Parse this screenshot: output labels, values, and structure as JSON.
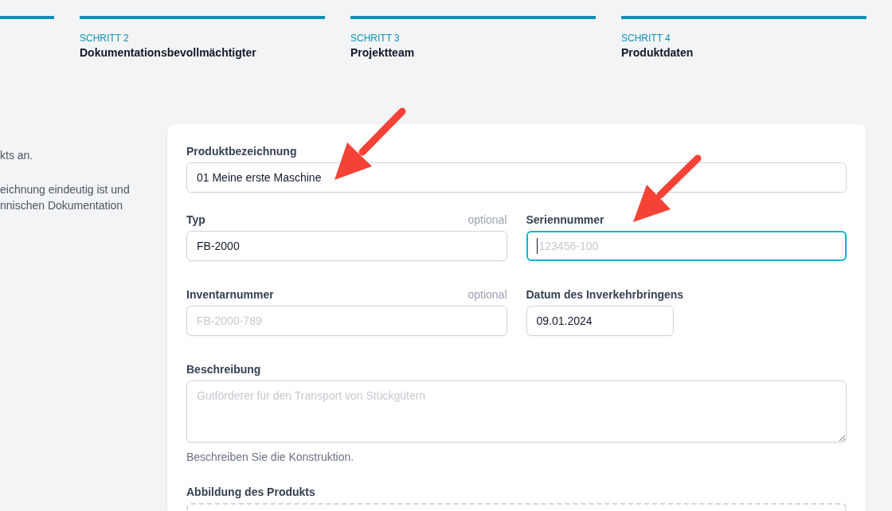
{
  "steps": [
    {
      "complete": true
    },
    {
      "label": "SCHRITT 2",
      "title": "Dokumentationsbevollmächtigter",
      "complete": true
    },
    {
      "label": "SCHRITT 3",
      "title": "Projektteam",
      "complete": true
    },
    {
      "label": "SCHRITT 4",
      "title": "Produktdaten",
      "complete": true
    }
  ],
  "intro": [
    {
      "lines": [
        "kts an."
      ]
    },
    {
      "lines": [
        "eichnung eindeutig ist und",
        "nnischen Dokumentation"
      ]
    }
  ],
  "form": {
    "rows": [
      [
        {
          "kind": "text",
          "label": "Produktbezeichnung",
          "value": "01 Meine erste Maschine",
          "focused": false
        }
      ],
      [
        {
          "kind": "text",
          "label": "Typ",
          "note": "optional",
          "value": "FB-2000",
          "focused": false
        },
        {
          "kind": "text",
          "label": "Seriennummer",
          "placeholder": "123456-100",
          "focused": true
        }
      ],
      [
        {
          "kind": "text",
          "label": "Inventarnummer",
          "note": "optional",
          "placeholder": "FB-2000-789",
          "focused": false
        },
        {
          "kind": "date",
          "label": "Datum des Inverkehrbringens",
          "value": "09.01.2024",
          "focused": false
        }
      ],
      [
        {
          "kind": "textarea",
          "label": "Beschreibung",
          "placeholder": "Gutförderer für den Transport von Stückgütern",
          "help": "Beschreiben Sie die Konstruktion.",
          "focused": false
        }
      ],
      [
        {
          "kind": "upload",
          "label": "Abbildung des Produkts"
        }
      ]
    ]
  }
}
